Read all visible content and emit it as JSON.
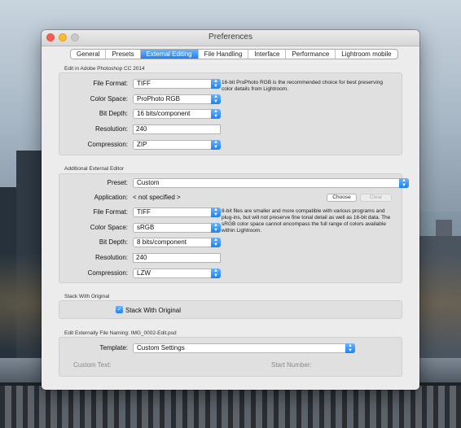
{
  "window": {
    "title": "Preferences"
  },
  "tabs": [
    {
      "label": "General",
      "active": false
    },
    {
      "label": "Presets",
      "active": false
    },
    {
      "label": "External Editing",
      "active": true
    },
    {
      "label": "File Handling",
      "active": false
    },
    {
      "label": "Interface",
      "active": false
    },
    {
      "label": "Performance",
      "active": false
    },
    {
      "label": "Lightroom mobile",
      "active": false
    }
  ],
  "photoshop": {
    "section_title": "Edit in Adobe Photoshop CC 2014",
    "file_format_label": "File Format:",
    "file_format": "TIFF",
    "color_space_label": "Color Space:",
    "color_space": "ProPhoto RGB",
    "bit_depth_label": "Bit Depth:",
    "bit_depth": "16 bits/component",
    "resolution_label": "Resolution:",
    "resolution": "240",
    "compression_label": "Compression:",
    "compression": "ZIP",
    "note": "16-bit ProPhoto RGB is the recommended choice for best preserving color details from Lightroom."
  },
  "additional": {
    "section_title": "Additional External Editor",
    "preset_label": "Preset:",
    "preset": "Custom",
    "application_label": "Application:",
    "application": "< not specified >",
    "choose_label": "Choose",
    "clear_label": "Clear",
    "file_format_label": "File Format:",
    "file_format": "TIFF",
    "color_space_label": "Color Space:",
    "color_space": "sRGB",
    "bit_depth_label": "Bit Depth:",
    "bit_depth": "8 bits/component",
    "resolution_label": "Resolution:",
    "resolution": "240",
    "compression_label": "Compression:",
    "compression": "LZW",
    "note": "8-bit files are smaller and more compatible with various programs and plug-ins, but will not preserve fine tonal detail as well as 16-bit data. The sRGB color space cannot encompass the full range of colors available within Lightroom."
  },
  "stack": {
    "section_title": "Stack With Original",
    "checkbox_label": "Stack With Original",
    "checked": true
  },
  "naming": {
    "section_title": "Edit Externally File Naming:",
    "example": "IMG_0002-Edit.psd",
    "template_label": "Template:",
    "template": "Custom Settings",
    "custom_text_label": "Custom Text:",
    "start_number_label": "Start Number:"
  },
  "colors": {
    "accent": "#1a82f7",
    "window_bg": "#ececec",
    "panel_bg": "#e0e0e0"
  }
}
